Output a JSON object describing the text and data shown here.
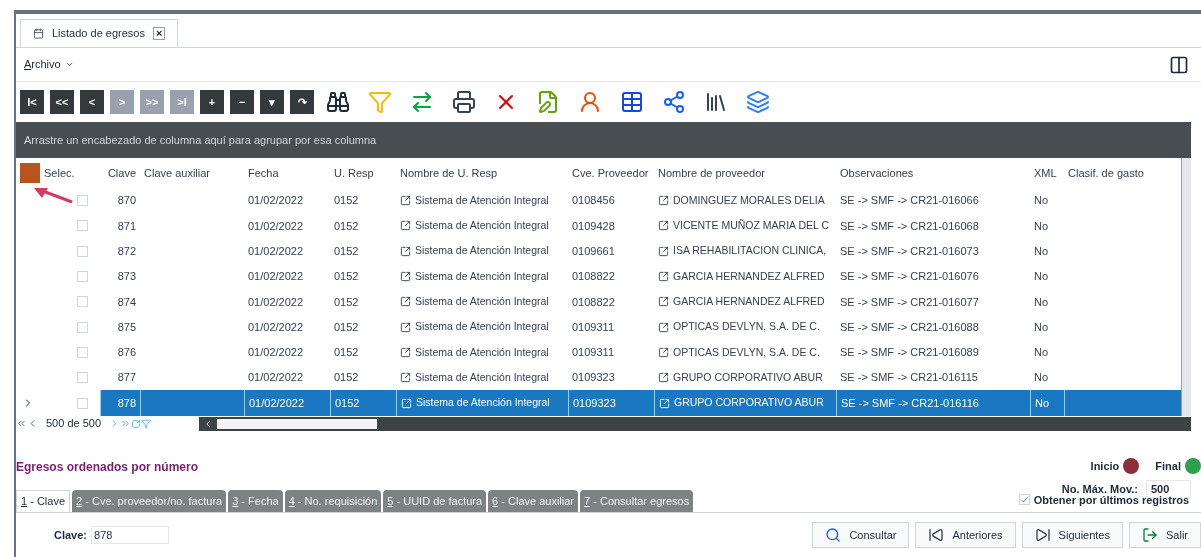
{
  "doc_tab": {
    "label": "Listado de egresos",
    "close": "×"
  },
  "menu": {
    "label": "Archivo"
  },
  "nav_buttons": [
    {
      "label": "I<",
      "disabled": false
    },
    {
      "label": "<<",
      "disabled": false
    },
    {
      "label": "<",
      "disabled": false
    },
    {
      "label": ">",
      "disabled": true
    },
    {
      "label": ">>",
      "disabled": true
    },
    {
      "label": ">I",
      "disabled": true
    },
    {
      "label": "+",
      "disabled": false
    },
    {
      "label": "−",
      "disabled": false
    },
    {
      "label": "▾",
      "disabled": false
    },
    {
      "label": "↷",
      "disabled": false
    }
  ],
  "group_hint": "Arrastre un encabezado de columna aquí para agrupar por esa columna",
  "table": {
    "columns": [
      "Selec.",
      "Clave",
      "Clave auxiliar",
      "Fecha",
      "U. Resp",
      "Nombre de U. Resp",
      "Cve. Proveedor",
      "Nombre de proveedor",
      "Observaciones",
      "XML",
      "Clasif. de gasto"
    ],
    "rows": [
      {
        "checked": false,
        "selected": false,
        "clave": "870",
        "fecha": "01/02/2022",
        "uresp": "0152",
        "nombre_uresp": "Sistema de Atención Integral",
        "cve_prov": "0108456",
        "proveedor": "DOMINGUEZ MORALES DELIA",
        "obs": "SE -> SMF -> CR21-016066",
        "xml": "No"
      },
      {
        "checked": false,
        "selected": false,
        "clave": "871",
        "fecha": "01/02/2022",
        "uresp": "0152",
        "nombre_uresp": "Sistema de Atención Integral",
        "cve_prov": "0109428",
        "proveedor": "VICENTE MUÑOZ MARIA DEL C",
        "obs": "SE -> SMF -> CR21-016068",
        "xml": "No"
      },
      {
        "checked": false,
        "selected": false,
        "clave": "872",
        "fecha": "01/02/2022",
        "uresp": "0152",
        "nombre_uresp": "Sistema de Atención Integral",
        "cve_prov": "0109661",
        "proveedor": "ISA REHABILITACION CLINICA,",
        "obs": "SE -> SMF -> CR21-016073",
        "xml": "No"
      },
      {
        "checked": false,
        "selected": false,
        "clave": "873",
        "fecha": "01/02/2022",
        "uresp": "0152",
        "nombre_uresp": "Sistema de Atención Integral",
        "cve_prov": "0108822",
        "proveedor": "GARCIA HERNANDEZ ALFRED",
        "obs": "SE -> SMF -> CR21-016076",
        "xml": "No"
      },
      {
        "checked": false,
        "selected": false,
        "clave": "874",
        "fecha": "01/02/2022",
        "uresp": "0152",
        "nombre_uresp": "Sistema de Atención Integral",
        "cve_prov": "0108822",
        "proveedor": "GARCIA HERNANDEZ ALFRED",
        "obs": "SE -> SMF -> CR21-016077",
        "xml": "No"
      },
      {
        "checked": false,
        "selected": false,
        "clave": "875",
        "fecha": "01/02/2022",
        "uresp": "0152",
        "nombre_uresp": "Sistema de Atención Integral",
        "cve_prov": "0109311",
        "proveedor": "OPTICAS DEVLYN, S.A. DE C.",
        "obs": "SE -> SMF -> CR21-016088",
        "xml": "No"
      },
      {
        "checked": false,
        "selected": false,
        "clave": "876",
        "fecha": "01/02/2022",
        "uresp": "0152",
        "nombre_uresp": "Sistema de Atención Integral",
        "cve_prov": "0109311",
        "proveedor": "OPTICAS DEVLYN, S.A. DE C.",
        "obs": "SE -> SMF -> CR21-016089",
        "xml": "No"
      },
      {
        "checked": false,
        "selected": false,
        "clave": "877",
        "fecha": "01/02/2022",
        "uresp": "0152",
        "nombre_uresp": "Sistema de Atención Integral",
        "cve_prov": "0109323",
        "proveedor": "GRUPO CORPORATIVO ABUR",
        "obs": "SE -> SMF -> CR21-016115",
        "xml": "No"
      },
      {
        "checked": false,
        "selected": true,
        "clave": "878",
        "fecha": "01/02/2022",
        "uresp": "0152",
        "nombre_uresp": "Sistema de Atención Integral",
        "cve_prov": "0109323",
        "proveedor": "GRUPO CORPORATIVO ABUR",
        "obs": "SE -> SMF -> CR21-016116",
        "xml": "No"
      }
    ]
  },
  "pager": {
    "count": "500 de 500"
  },
  "order_title": "Egresos ordenados por número",
  "markers": [
    {
      "label": "Inicio",
      "color": "#8b2f3a"
    },
    {
      "label": "Final",
      "color": "#2e9e4f"
    }
  ],
  "max_mov": {
    "label": "No. Máx. Mov.:",
    "value": "500"
  },
  "last_records": {
    "label": "Obtener por últimos registros",
    "checked": true
  },
  "search_tabs": [
    {
      "label": "1 - Clave",
      "selected": true
    },
    {
      "label": "2 - Cve. proveedor/no. factura",
      "selected": false
    },
    {
      "label": "3 - Fecha",
      "selected": false
    },
    {
      "label": "4 - No. requisición",
      "selected": false
    },
    {
      "label": "5 - UUID de factura",
      "selected": false
    },
    {
      "label": "6 - Clave auxiliar",
      "selected": false
    },
    {
      "label": "7 - Consultar egresos",
      "selected": false
    }
  ],
  "clave_field": {
    "label": "Clave:",
    "value": "878"
  },
  "buttons": [
    {
      "kind": "search",
      "label": "Consultar"
    },
    {
      "kind": "prev",
      "label": "Anteriores"
    },
    {
      "kind": "next",
      "label": "Siguientes"
    },
    {
      "kind": "exit",
      "label": "Salir"
    }
  ]
}
